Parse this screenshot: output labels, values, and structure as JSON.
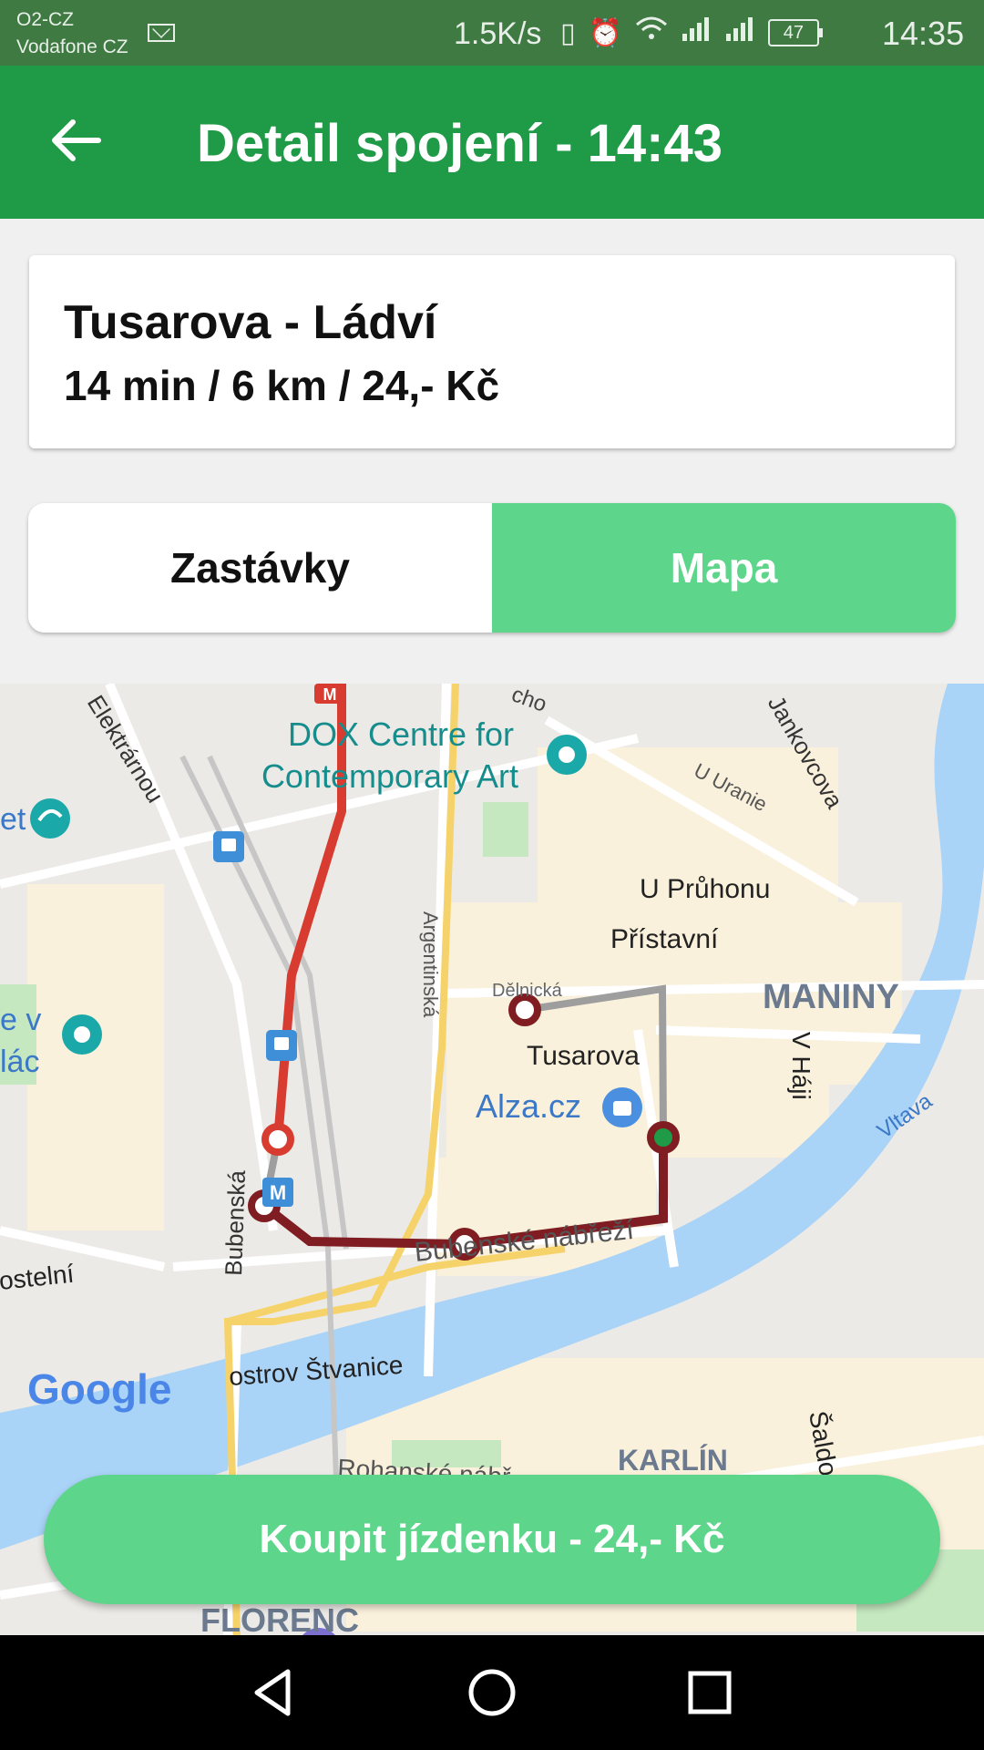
{
  "status_bar": {
    "carrier_line1": "O2-CZ",
    "carrier_line2": "Vodafone CZ",
    "net_speed": "1.5K/s",
    "battery": "47",
    "time": "14:35",
    "icons": [
      "mail-icon",
      "vibrate-icon",
      "alarm-icon",
      "wifi-icon",
      "signal-icon",
      "signal-icon-2",
      "battery-icon"
    ]
  },
  "app_bar": {
    "title": "Detail spojení - 14:43",
    "back_icon": "arrow-left-icon"
  },
  "summary": {
    "title": "Tusarova - Ládví",
    "meta": "14 min / 6 km / 24,- Kč"
  },
  "tabs": [
    {
      "label": "Zastávky",
      "selected": false
    },
    {
      "label": "Mapa",
      "selected": true
    }
  ],
  "map": {
    "labels": {
      "dox": "DOX Centre for",
      "dox2": "Contemporary Art",
      "elektrarnou": "Elektrárnou",
      "jankovcova": "Jankovcova",
      "u_uranie": "U Uranie",
      "u_pruhonu": "U Průhonu",
      "pristavni": "Přístavní",
      "delnicka": "Dělnická",
      "maniny": "MANINY",
      "argentinska": "Argentinská",
      "tusarova": "Tusarova",
      "alza": "Alza.cz",
      "v_haji": "V Háji",
      "vltava": "Vltava",
      "bubenska": "Bubenská",
      "bubenske_nabrezi": "Bubenské nábřeží",
      "ostelni": "ostelní",
      "ostrov": "ostrov Štvanice",
      "karlin": "KARLÍN",
      "rohanske": "Rohanské nábř.",
      "saldo": "Šaldo",
      "florenc": "FLORENC",
      "cho": "cho",
      "ev": "e v",
      "lac": "lác",
      "et": "et",
      "google": "Google"
    },
    "colors": {
      "red_line": "#d83b30",
      "maroon_line": "#7f1d22",
      "gray_line": "#9e9e9e",
      "water": "#a9d3f7",
      "land": "#eceae6",
      "built": "#faf1dc",
      "park": "#c5e8c0"
    }
  },
  "buy_button": {
    "label": "Koupit jízdenku - 24,- Kč"
  },
  "nav_bar": {
    "icons": [
      "back-triangle-icon",
      "home-circle-icon",
      "recents-square-icon"
    ]
  }
}
